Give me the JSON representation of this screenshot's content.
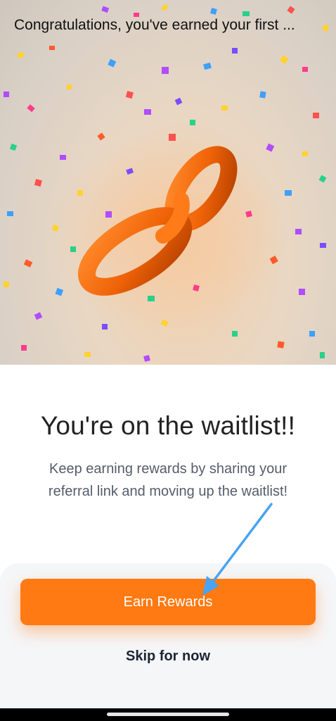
{
  "header": {
    "title": "Congratulations, you've earned your first ..."
  },
  "hero": {
    "illustration_icon": "chain-link-icon",
    "confetti": true,
    "link_color": "#ff6a00"
  },
  "main": {
    "heading": "You're on the waitlist!!",
    "description": "Keep earning rewards by sharing your referral link and moving up the waitlist!"
  },
  "actions": {
    "primary_label": "Earn Rewards",
    "secondary_label": "Skip for now",
    "primary_color": "#ff7a12"
  },
  "annotation": {
    "arrow_color": "#4aa3f0"
  }
}
